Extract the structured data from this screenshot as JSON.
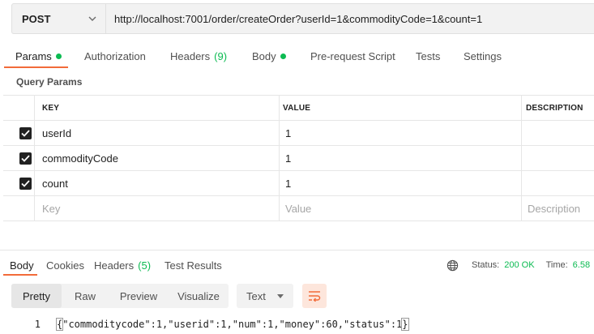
{
  "request": {
    "method": "POST",
    "url": "http://localhost:7001/order/createOrder?userId=1&commodityCode=1&count=1"
  },
  "request_tabs": [
    {
      "label": "Params",
      "dot": true,
      "count": ""
    },
    {
      "label": "Authorization",
      "dot": false,
      "count": ""
    },
    {
      "label": "Headers",
      "dot": false,
      "count": "(9)"
    },
    {
      "label": "Body",
      "dot": true,
      "count": ""
    },
    {
      "label": "Pre-request Script",
      "dot": false,
      "count": ""
    },
    {
      "label": "Tests",
      "dot": false,
      "count": ""
    },
    {
      "label": "Settings",
      "dot": false,
      "count": ""
    }
  ],
  "query_params": {
    "title": "Query Params",
    "headers": {
      "key": "KEY",
      "value": "VALUE",
      "description": "DESCRIPTION"
    },
    "rows": [
      {
        "key": "userId",
        "value": "1",
        "description": "",
        "checked": true
      },
      {
        "key": "commodityCode",
        "value": "1",
        "description": "",
        "checked": true
      },
      {
        "key": "count",
        "value": "1",
        "description": "",
        "checked": true
      }
    ],
    "placeholders": {
      "key": "Key",
      "value": "Value",
      "description": "Description"
    }
  },
  "response_tabs": [
    {
      "label": "Body",
      "count": ""
    },
    {
      "label": "Cookies",
      "count": ""
    },
    {
      "label": "Headers",
      "count": "(5)"
    },
    {
      "label": "Test Results",
      "count": ""
    }
  ],
  "status": {
    "status_label": "Status:",
    "status_value": "200 OK",
    "time_label": "Time:",
    "time_value": "6.58"
  },
  "format_buttons": [
    "Pretty",
    "Raw",
    "Preview",
    "Visualize"
  ],
  "body_type": "Text",
  "response_body": {
    "line_number": "1",
    "text_open": "{",
    "text_mid": "\"commoditycode\":1,\"userid\":1,\"num\":1,\"money\":60,\"status\":1",
    "text_close": "}"
  },
  "colors": {
    "accent": "#f26b3a",
    "success": "#0cbb52"
  },
  "icons": [
    "chevron-down-icon",
    "checkbox-checked-icon",
    "globe-icon",
    "wrap-lines-icon"
  ]
}
